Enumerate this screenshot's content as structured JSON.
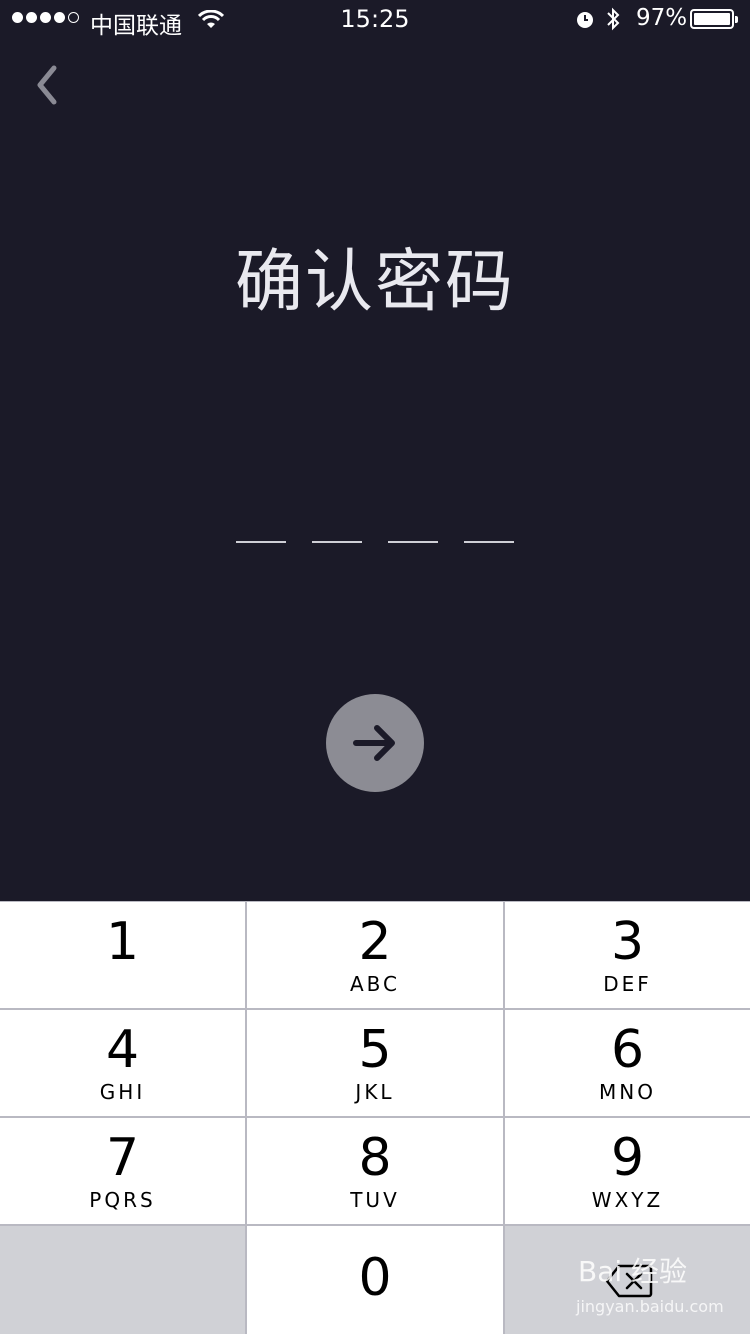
{
  "status_bar": {
    "carrier": "中国联通",
    "time": "15:25",
    "battery": "97%",
    "battery_level": 0.97,
    "signal_bars_filled": 4,
    "signal_bars_total": 5
  },
  "header": {
    "back_icon": "chevron-left-icon",
    "title": "确认密码"
  },
  "passcode": {
    "length": 4,
    "entered": 0
  },
  "submit": {
    "icon": "arrow-right-icon",
    "color": "#8c8c94"
  },
  "keypad": {
    "keys": [
      {
        "num": "1",
        "letters": ""
      },
      {
        "num": "2",
        "letters": "ABC"
      },
      {
        "num": "3",
        "letters": "DEF"
      },
      {
        "num": "4",
        "letters": "GHI"
      },
      {
        "num": "5",
        "letters": "JKL"
      },
      {
        "num": "6",
        "letters": "MNO"
      },
      {
        "num": "7",
        "letters": "PQRS"
      },
      {
        "num": "8",
        "letters": "TUV"
      },
      {
        "num": "9",
        "letters": "WXYZ"
      }
    ],
    "zero": "0",
    "delete_icon": "backspace-icon"
  },
  "watermark": {
    "logo_text": "Bai 经验",
    "url": "jingyan.baidu.com"
  },
  "colors": {
    "background": "#1b1a28",
    "keypad_bg": "#ffffff",
    "keypad_gray": "#d0d1d6"
  }
}
